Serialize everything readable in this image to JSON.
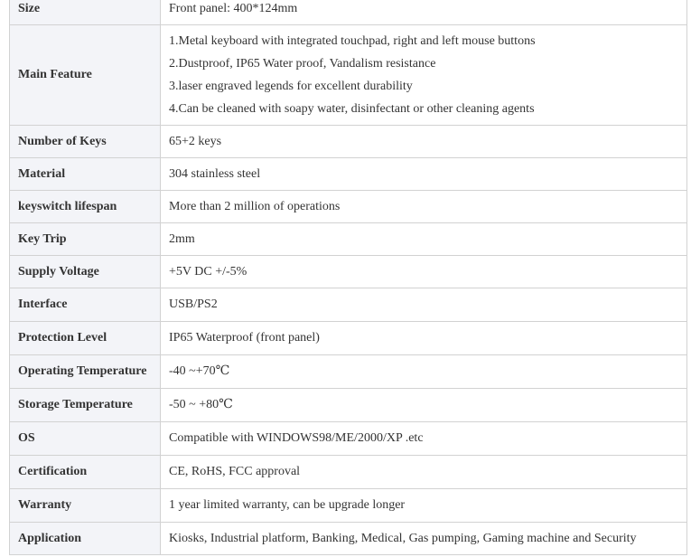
{
  "specs": {
    "rows": [
      {
        "label": "Size",
        "value": "Front panel: 400*124mm"
      },
      {
        "label": "Main Feature",
        "lines": [
          "1.Metal keyboard with integrated touchpad, right and left mouse buttons",
          "2.Dustproof, IP65 Water proof, Vandalism resistance",
          "3.laser engraved legends for excellent durability",
          "4.Can be cleaned with soapy water, disinfectant or other cleaning agents"
        ]
      },
      {
        "label": "Number of Keys",
        "value": "65+2 keys"
      },
      {
        "label": "Material",
        "value": "304 stainless steel"
      },
      {
        "label": "keyswitch lifespan",
        "value": "More than 2 million of operations"
      },
      {
        "label": "Key Trip",
        "value": "2mm"
      },
      {
        "label": "Supply Voltage",
        "value": "+5V DC +/-5%"
      },
      {
        "label": "Interface",
        "value": "USB/PS2"
      },
      {
        "label": "Protection Level",
        "value": "IP65 Waterproof (front panel)"
      },
      {
        "label": "Operating Temperature",
        "value": "-40 ~+70℃"
      },
      {
        "label": "Storage Temperature",
        "value": "-50 ~ +80℃"
      },
      {
        "label": "OS",
        "value": "Compatible with WINDOWS98/ME/2000/XP .etc"
      },
      {
        "label": "Certification",
        "value": "CE, RoHS, FCC approval"
      },
      {
        "label": "Warranty",
        "value": "1 year limited warranty, can be upgrade longer"
      },
      {
        "label": "Application",
        "value": "Kiosks, Industrial platform, Banking, Medical, Gas pumping, Gaming machine and Security"
      }
    ]
  },
  "colors": {
    "label_background": "#f3f4f8",
    "value_background": "#ffffff",
    "border": "#d2d2d2",
    "text": "#333333"
  }
}
